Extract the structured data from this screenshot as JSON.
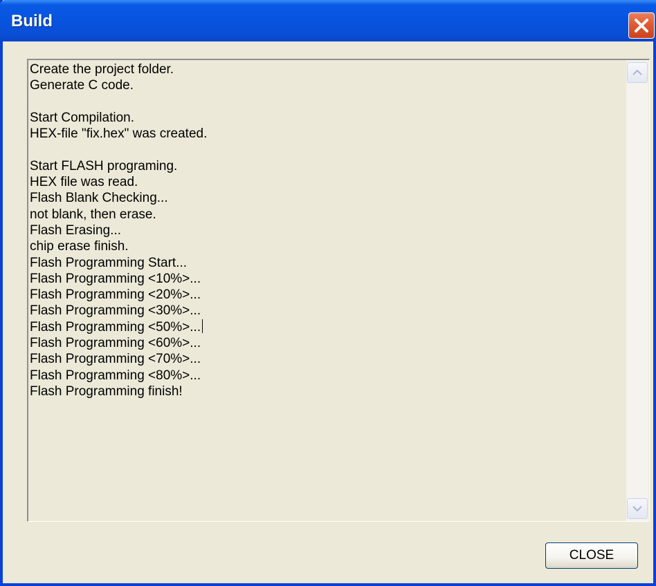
{
  "window": {
    "title": "Build"
  },
  "log": {
    "lines": [
      "Create the project folder.",
      "Generate C code.",
      "",
      "Start Compilation.",
      "HEX-file \"fix.hex\" was created.",
      "",
      "Start FLASH programing.",
      "HEX file was read.",
      "Flash Blank Checking...",
      "not blank, then erase.",
      "Flash Erasing...",
      "chip erase finish.",
      "Flash Programming Start...",
      "Flash Programming <10%>...",
      "Flash Programming <20%>...",
      "Flash Programming <30%>...",
      "Flash Programming <50%>...",
      "Flash Programming <60%>...",
      "Flash Programming <70%>...",
      "Flash Programming <80%>...",
      "Flash Programming finish!"
    ]
  },
  "buttons": {
    "close_label": "CLOSE"
  },
  "colors": {
    "titlebar": "#0754e0",
    "close_x": "#e15a32",
    "dialog_bg": "#ece9d8"
  }
}
